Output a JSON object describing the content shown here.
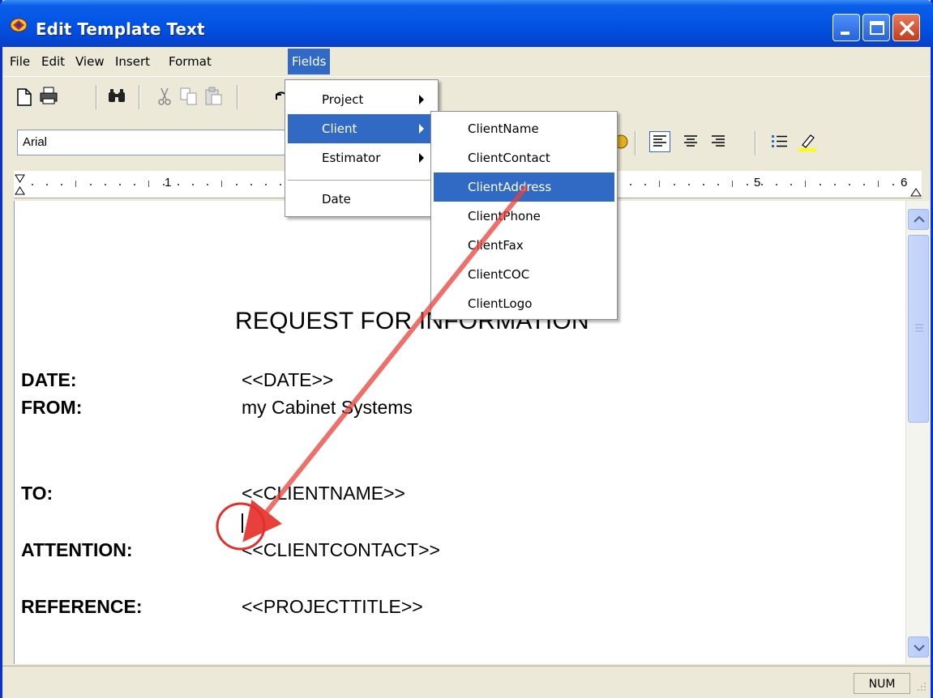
{
  "window": {
    "title": "Edit Template Text"
  },
  "menubar": {
    "items": [
      "File",
      "Edit",
      "View",
      "Insert",
      "Format",
      "Fields"
    ],
    "active": "Fields"
  },
  "toolbar": {
    "icons": [
      "new-document-icon",
      "print-icon",
      "find-icon",
      "cut-icon",
      "copy-icon",
      "paste-icon",
      "undo-icon"
    ],
    "format_icons": [
      "color-icon",
      "align-left-icon",
      "align-center-icon",
      "align-right-icon",
      "bullets-icon",
      "highlight-icon"
    ]
  },
  "font": {
    "name": "Arial"
  },
  "ruler": {
    "labels": [
      "1",
      "5",
      "6"
    ]
  },
  "fields_menu": {
    "items": [
      {
        "label": "Project",
        "submenu": true
      },
      {
        "label": "Client",
        "submenu": true
      },
      {
        "label": "Estimator",
        "submenu": true
      },
      {
        "label": "Date",
        "submenu": false
      }
    ],
    "highlighted": "Client"
  },
  "client_menu": {
    "items": [
      "ClientName",
      "ClientContact",
      "ClientAddress",
      "ClientPhone",
      "ClientFax",
      "ClientCOC",
      "ClientLogo"
    ],
    "highlighted": "ClientAddress"
  },
  "document": {
    "heading": "REQUEST FOR INFORMATION",
    "rows": [
      {
        "label": "DATE:",
        "value": "<<DATE>>"
      },
      {
        "label": "FROM:",
        "value": "my Cabinet Systems"
      },
      {
        "label": "TO:",
        "value": "<<CLIENTNAME>>"
      },
      {
        "label": "ATTENTION:",
        "value": "<<CLIENTCONTACT>>"
      },
      {
        "label": "REFERENCE:",
        "value": "<<PROJECTTITLE>>"
      }
    ]
  },
  "statusbar": {
    "num": "NUM"
  },
  "colors": {
    "titlebar": "#0354e4",
    "menu_highlight": "#316ac5",
    "annotation": "#e8403a"
  }
}
